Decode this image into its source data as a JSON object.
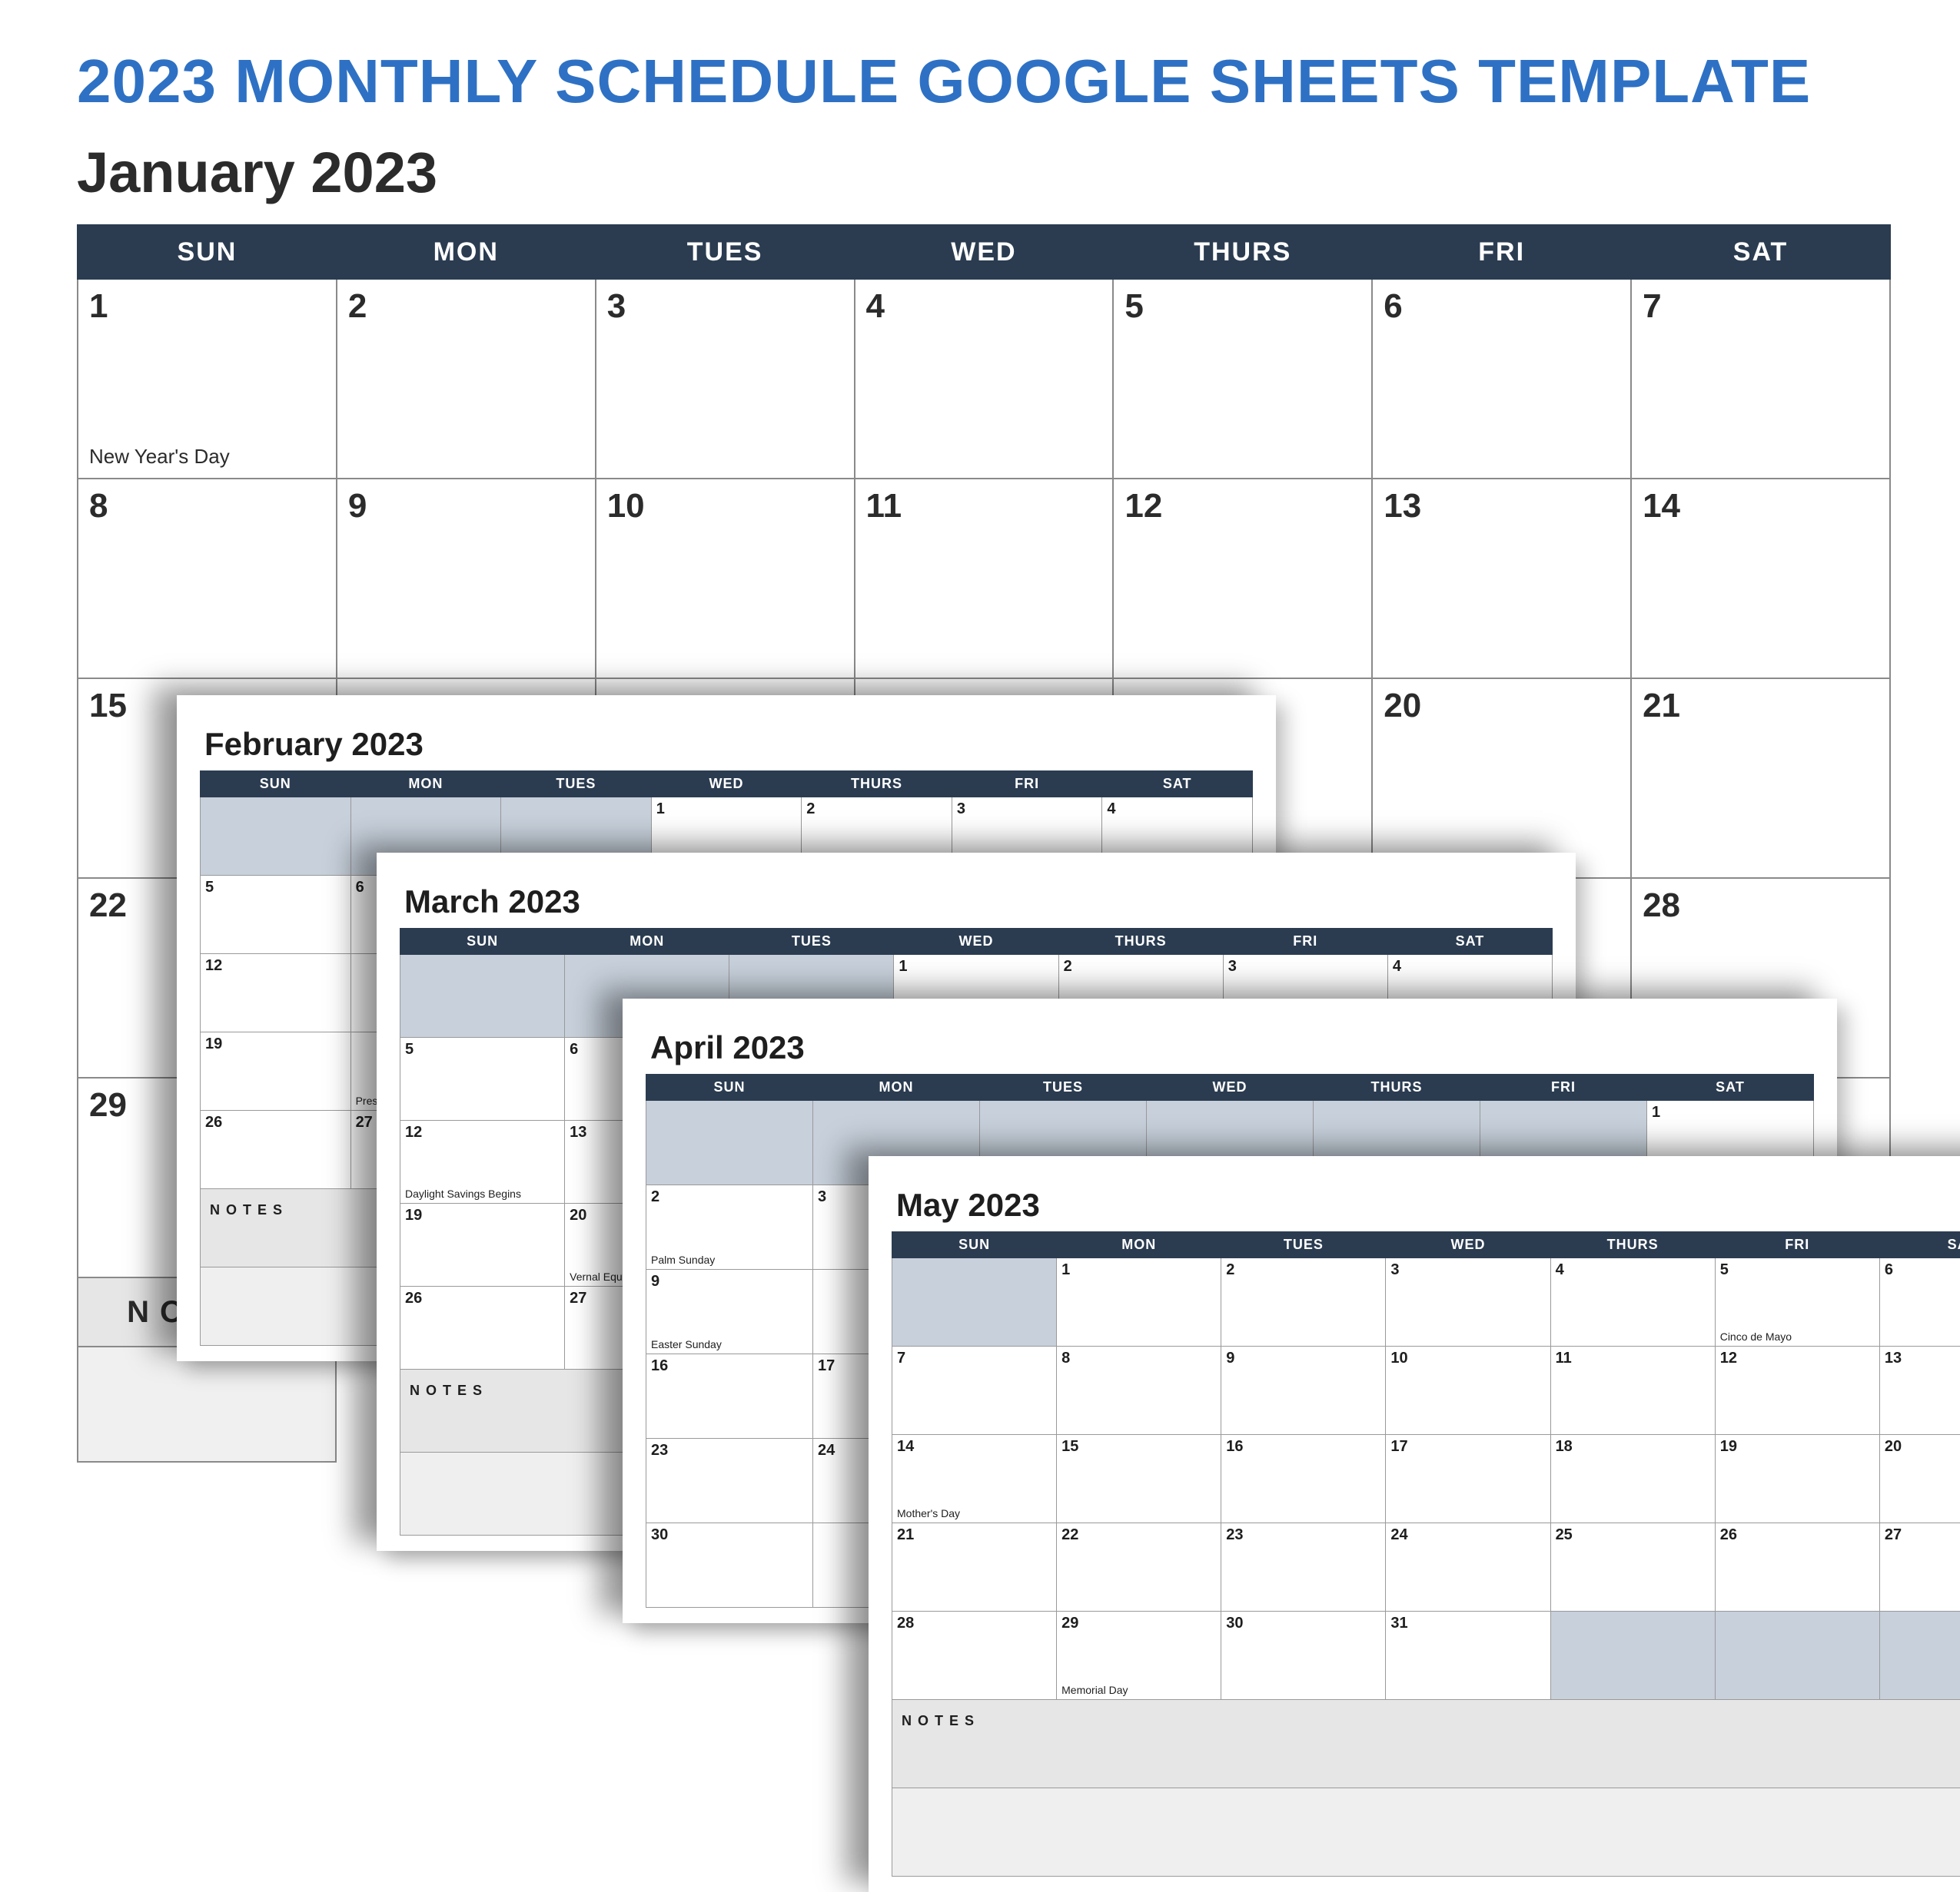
{
  "title": "2023 MONTHLY SCHEDULE GOOGLE SHEETS TEMPLATE",
  "day_headers_full": [
    "SUN",
    "MON",
    "TUES",
    "WED",
    "THURS",
    "FRI",
    "SAT"
  ],
  "notes_label": "NOTES",
  "january": {
    "title": "January 2023",
    "weeks": [
      [
        {
          "n": "1",
          "ev": "New Year's Day"
        },
        {
          "n": "2"
        },
        {
          "n": "3"
        },
        {
          "n": "4"
        },
        {
          "n": "5"
        },
        {
          "n": "6"
        },
        {
          "n": "7"
        }
      ],
      [
        {
          "n": "8"
        },
        {
          "n": "9"
        },
        {
          "n": "10"
        },
        {
          "n": "11"
        },
        {
          "n": "12"
        },
        {
          "n": "13"
        },
        {
          "n": "14"
        }
      ],
      [
        {
          "n": "15"
        },
        {
          "n": ""
        },
        {
          "n": ""
        },
        {
          "n": ""
        },
        {
          "n": ""
        },
        {
          "n": "20"
        },
        {
          "n": "21"
        }
      ],
      [
        {
          "n": "22"
        },
        {
          "n": ""
        },
        {
          "n": ""
        },
        {
          "n": ""
        },
        {
          "n": ""
        },
        {
          "n": ""
        },
        {
          "n": "28"
        }
      ],
      [
        {
          "n": "29"
        },
        {
          "n": ""
        },
        {
          "n": ""
        },
        {
          "n": ""
        },
        {
          "n": ""
        },
        {
          "n": ""
        },
        {
          "n": ""
        }
      ]
    ]
  },
  "february": {
    "title": "February 2023",
    "weeks": [
      [
        {
          "g": true
        },
        {
          "g": true
        },
        {
          "g": true
        },
        {
          "n": "1"
        },
        {
          "n": "2"
        },
        {
          "n": "3"
        },
        {
          "n": "4"
        }
      ],
      [
        {
          "n": "5"
        },
        {
          "n": "6"
        },
        {
          "n": ""
        },
        {
          "n": ""
        },
        {
          "n": ""
        },
        {
          "n": ""
        },
        {
          "n": ""
        }
      ],
      [
        {
          "n": "12"
        },
        {
          "n": ""
        },
        {
          "n": ""
        },
        {
          "n": ""
        },
        {
          "n": ""
        },
        {
          "n": ""
        },
        {
          "n": ""
        }
      ],
      [
        {
          "n": "19"
        },
        {
          "n": "",
          "ev": "Preside"
        },
        {
          "n": ""
        },
        {
          "n": ""
        },
        {
          "n": ""
        },
        {
          "n": ""
        },
        {
          "n": ""
        }
      ],
      [
        {
          "n": "26"
        },
        {
          "n": "27"
        },
        {
          "n": ""
        },
        {
          "n": ""
        },
        {
          "n": ""
        },
        {
          "n": ""
        },
        {
          "n": ""
        }
      ]
    ],
    "notes": true
  },
  "march": {
    "title": "March 2023",
    "weeks": [
      [
        {
          "g": true
        },
        {
          "g": true
        },
        {
          "g": true
        },
        {
          "n": "1"
        },
        {
          "n": "2"
        },
        {
          "n": "3"
        },
        {
          "n": "4"
        }
      ],
      [
        {
          "n": "5"
        },
        {
          "n": "6"
        },
        {
          "n": ""
        },
        {
          "n": ""
        },
        {
          "n": ""
        },
        {
          "n": ""
        },
        {
          "n": ""
        }
      ],
      [
        {
          "n": "12",
          "ev": "Daylight Savings Begins"
        },
        {
          "n": "13"
        },
        {
          "n": ""
        },
        {
          "n": ""
        },
        {
          "n": ""
        },
        {
          "n": ""
        },
        {
          "n": ""
        }
      ],
      [
        {
          "n": "19"
        },
        {
          "n": "20",
          "ev": "Vernal Equinox"
        },
        {
          "n": ""
        },
        {
          "n": ""
        },
        {
          "n": ""
        },
        {
          "n": ""
        },
        {
          "n": ""
        }
      ],
      [
        {
          "n": "26"
        },
        {
          "n": "27"
        },
        {
          "n": ""
        },
        {
          "n": ""
        },
        {
          "n": ""
        },
        {
          "n": ""
        },
        {
          "n": ""
        }
      ]
    ],
    "notes": true
  },
  "april": {
    "title": "April 2023",
    "weeks": [
      [
        {
          "g": true
        },
        {
          "g": true
        },
        {
          "g": true
        },
        {
          "g": true
        },
        {
          "g": true
        },
        {
          "g": true
        },
        {
          "n": "1"
        }
      ],
      [
        {
          "n": "2",
          "ev": "Palm Sunday"
        },
        {
          "n": "3"
        },
        {
          "n": ""
        },
        {
          "n": ""
        },
        {
          "n": ""
        },
        {
          "n": ""
        },
        {
          "n": ""
        }
      ],
      [
        {
          "n": "9",
          "ev": "Easter Sunday"
        },
        {
          "n": ""
        },
        {
          "n": ""
        },
        {
          "n": ""
        },
        {
          "n": ""
        },
        {
          "n": ""
        },
        {
          "n": ""
        }
      ],
      [
        {
          "n": "16"
        },
        {
          "n": "17"
        },
        {
          "n": ""
        },
        {
          "n": ""
        },
        {
          "n": ""
        },
        {
          "n": ""
        },
        {
          "n": ""
        }
      ],
      [
        {
          "n": "23"
        },
        {
          "n": "24"
        },
        {
          "n": ""
        },
        {
          "n": ""
        },
        {
          "n": ""
        },
        {
          "n": ""
        },
        {
          "n": ""
        }
      ],
      [
        {
          "n": "30"
        },
        {
          "n": ""
        },
        {
          "n": ""
        },
        {
          "n": ""
        },
        {
          "n": ""
        },
        {
          "n": ""
        },
        {
          "n": ""
        }
      ]
    ]
  },
  "may": {
    "title": "May 2023",
    "weeks": [
      [
        {
          "g": true
        },
        {
          "n": "1"
        },
        {
          "n": "2"
        },
        {
          "n": "3"
        },
        {
          "n": "4"
        },
        {
          "n": "5",
          "ev": "Cinco de Mayo"
        },
        {
          "n": "6"
        }
      ],
      [
        {
          "n": "7"
        },
        {
          "n": "8"
        },
        {
          "n": "9"
        },
        {
          "n": "10"
        },
        {
          "n": "11"
        },
        {
          "n": "12"
        },
        {
          "n": "13"
        }
      ],
      [
        {
          "n": "14",
          "ev": "Mother's Day"
        },
        {
          "n": "15"
        },
        {
          "n": "16"
        },
        {
          "n": "17"
        },
        {
          "n": "18"
        },
        {
          "n": "19"
        },
        {
          "n": "20"
        }
      ],
      [
        {
          "n": "21"
        },
        {
          "n": "22"
        },
        {
          "n": "23"
        },
        {
          "n": "24"
        },
        {
          "n": "25"
        },
        {
          "n": "26"
        },
        {
          "n": "27"
        }
      ],
      [
        {
          "n": "28"
        },
        {
          "n": "29",
          "ev": "Memorial Day"
        },
        {
          "n": "30"
        },
        {
          "n": "31"
        },
        {
          "g": true
        },
        {
          "g": true
        },
        {
          "g": true
        }
      ]
    ],
    "notes": true
  }
}
